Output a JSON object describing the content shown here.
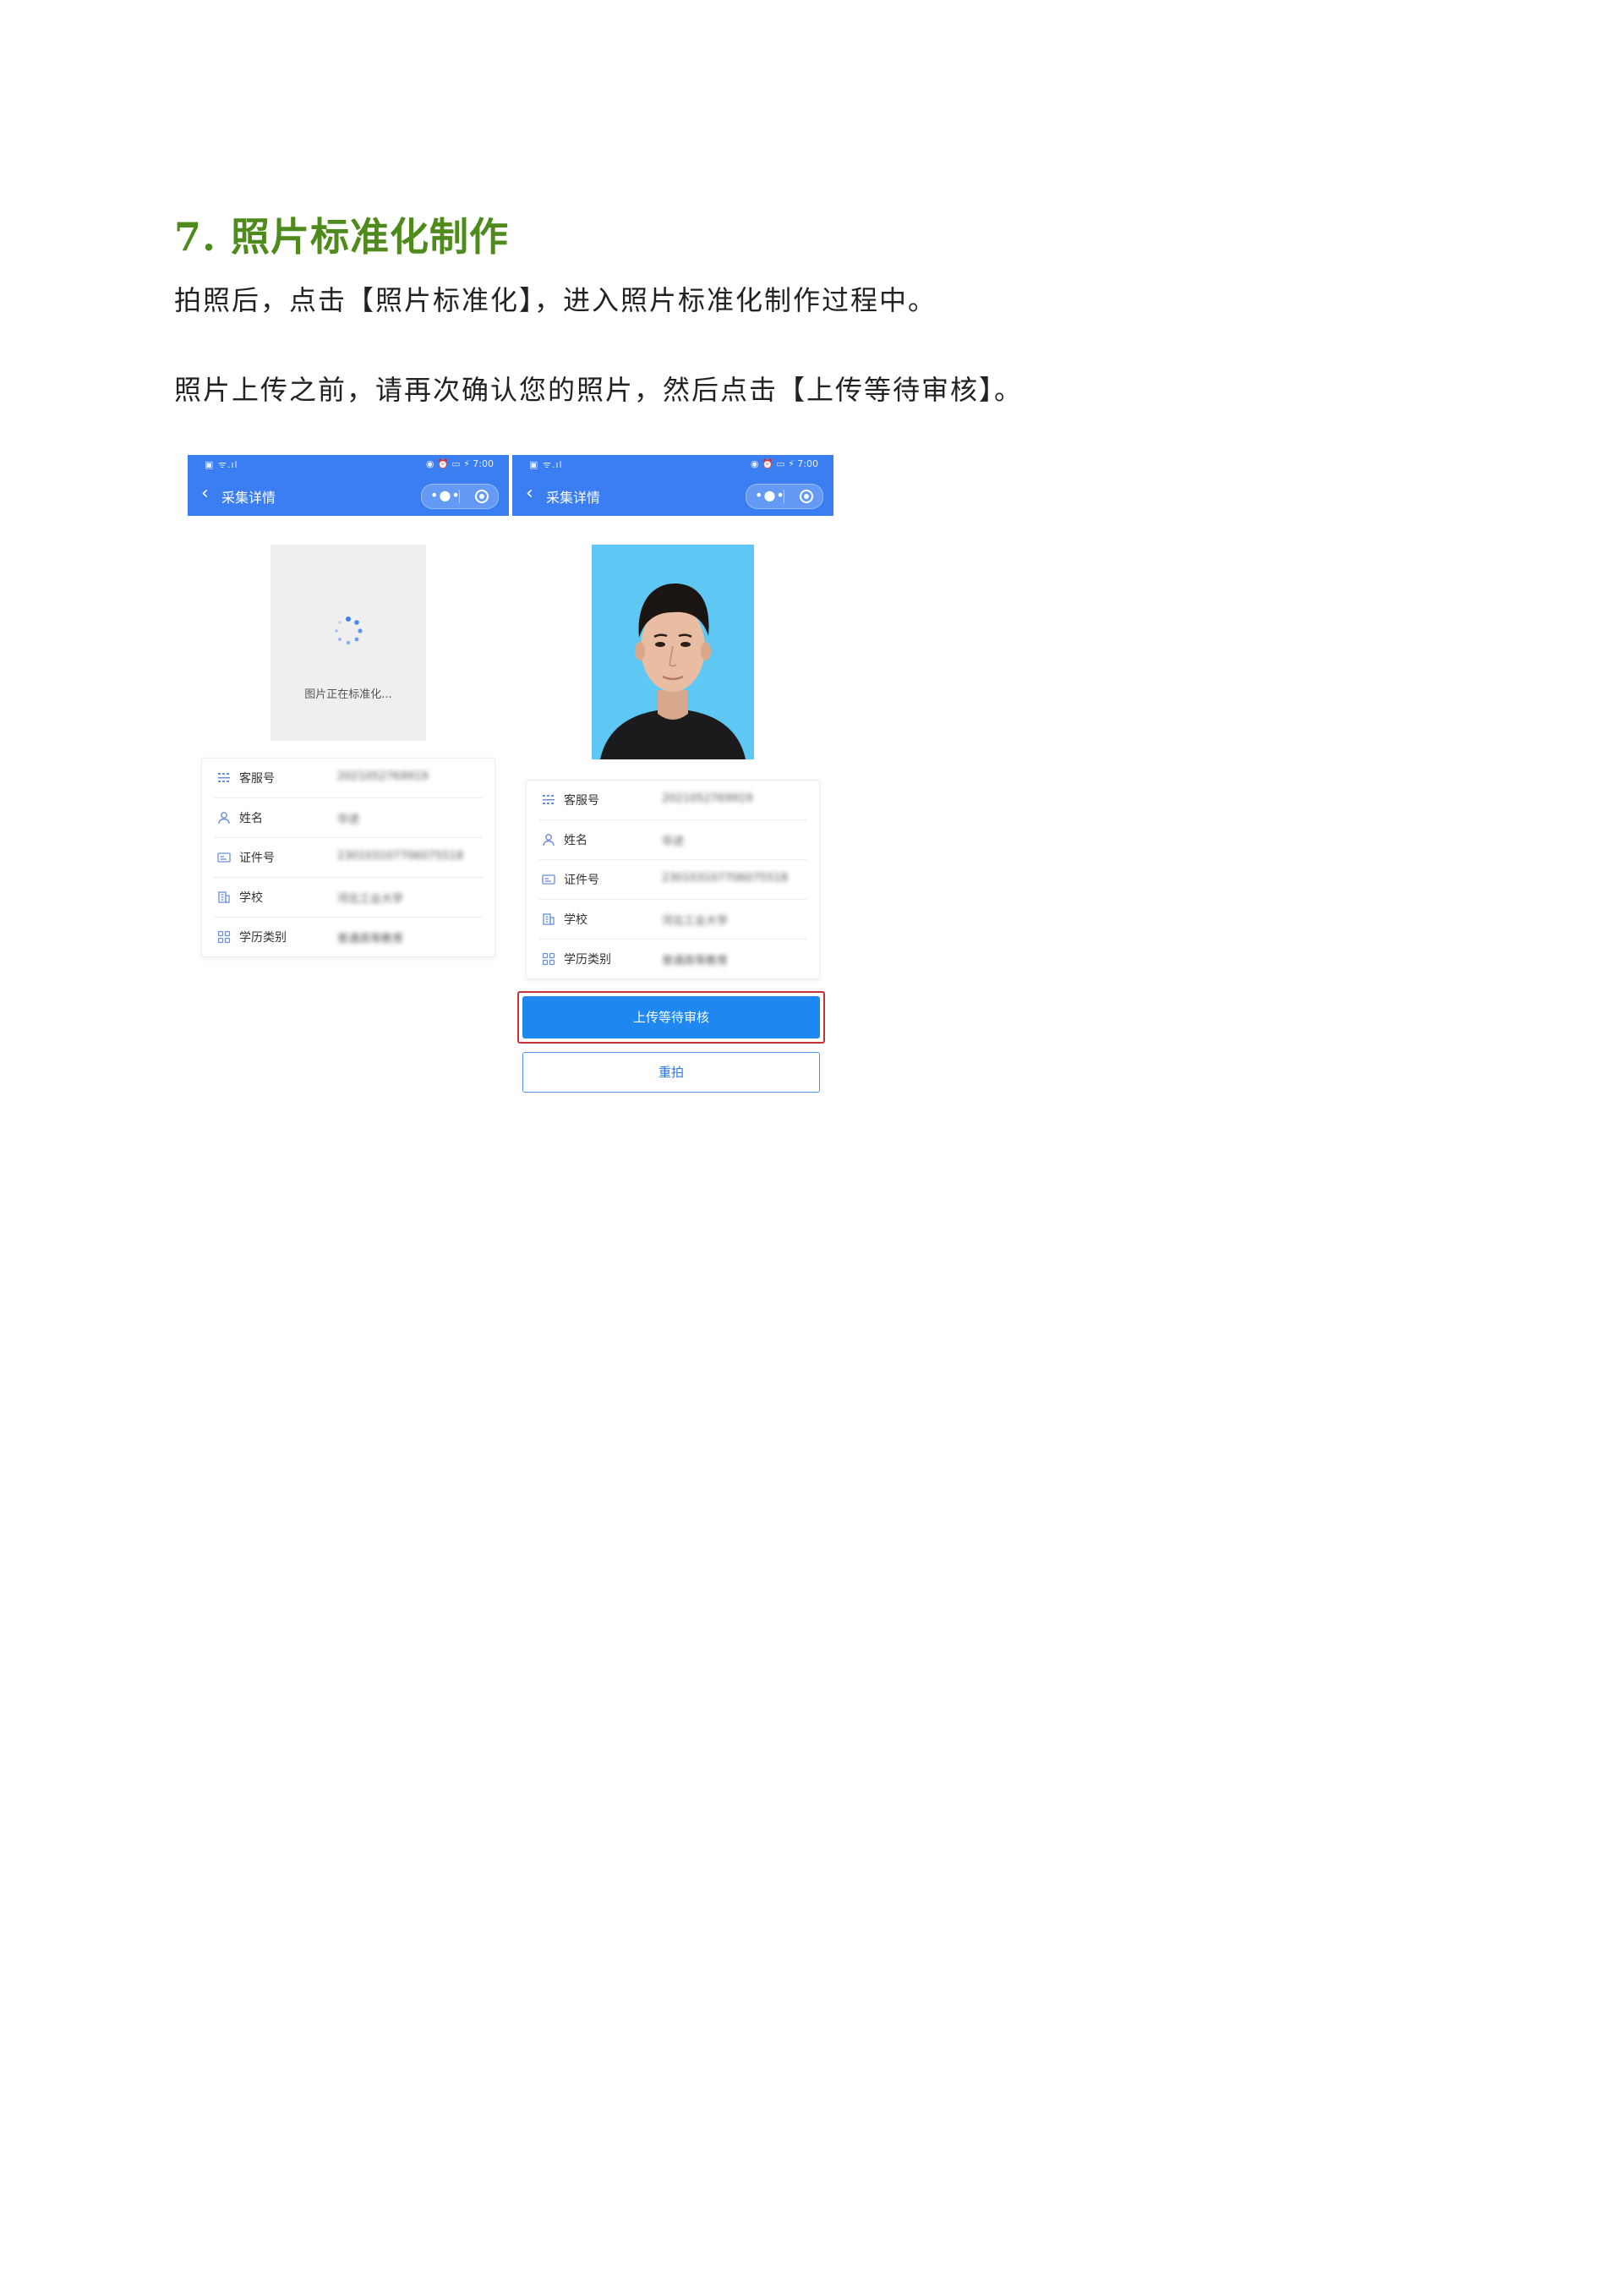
{
  "heading": "7. 照片标准化制作",
  "paragraph1": "拍照后，点击【照片标准化】，进入照片标准化制作过程中。",
  "paragraph2": "照片上传之前，请再次确认您的照片，然后点击【上传等待审核】。",
  "colors": {
    "heading": "#4e8a1c",
    "navbar": "#3a7ef1",
    "primary_button": "#1f88f0",
    "highlight_border": "#c9313a",
    "photo_background": "#5ec7f3"
  },
  "left_screen": {
    "status_time": "7:00",
    "nav_title": "采集详情",
    "loading_text": "图片正在标准化...",
    "fields": [
      {
        "icon": "grid-list-icon",
        "label": "客服号",
        "value": "2021052769919"
      },
      {
        "icon": "user-icon",
        "label": "姓名",
        "value": "华述"
      },
      {
        "icon": "id-card-icon",
        "label": "证件号",
        "value": "230103107706075518"
      },
      {
        "icon": "building-icon",
        "label": "学校",
        "value": "河北工业大学"
      },
      {
        "icon": "apps-icon",
        "label": "学历类别",
        "value": "普通高等教育"
      }
    ]
  },
  "right_screen": {
    "status_time": "7:00",
    "nav_title": "采集详情",
    "fields": [
      {
        "icon": "grid-list-icon",
        "label": "客服号",
        "value": "2021052769919"
      },
      {
        "icon": "user-icon",
        "label": "姓名",
        "value": "华述"
      },
      {
        "icon": "id-card-icon",
        "label": "证件号",
        "value": "230103107706075518"
      },
      {
        "icon": "building-icon",
        "label": "学校",
        "value": "河北工业大学"
      },
      {
        "icon": "apps-icon",
        "label": "学历类别",
        "value": "普通高等教育"
      }
    ],
    "upload_button": "上传等待审核",
    "retake_button": "重拍"
  }
}
